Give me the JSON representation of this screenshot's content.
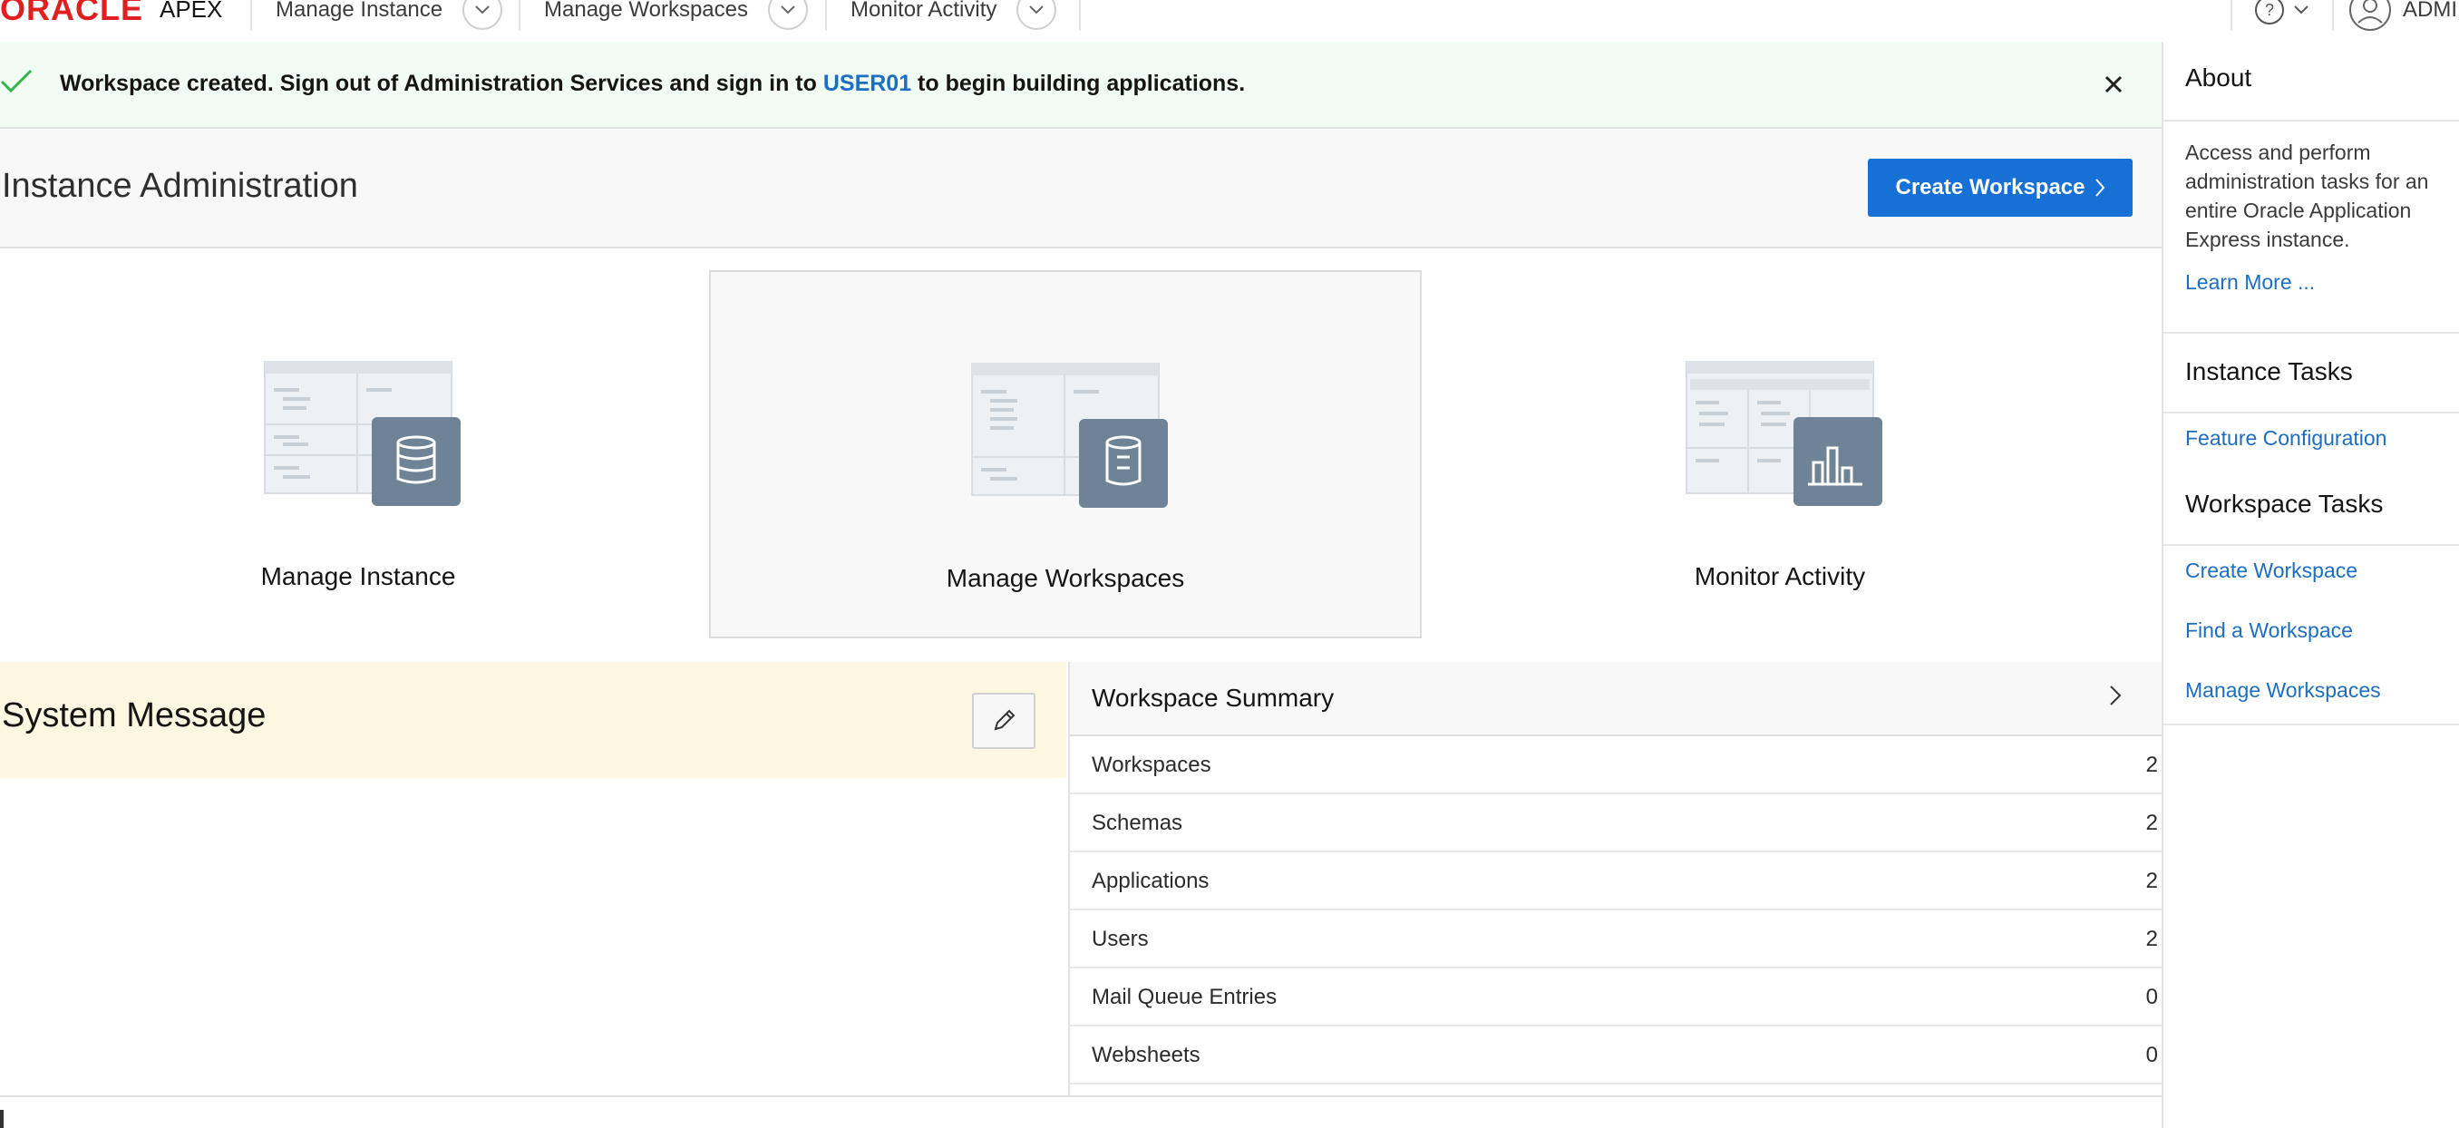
{
  "brand": {
    "logo_text": "ORACLE",
    "product": "APEX"
  },
  "nav": {
    "items": [
      {
        "label": "Manage Instance"
      },
      {
        "label": "Manage Workspaces"
      },
      {
        "label": "Monitor Activity"
      }
    ],
    "help_icon": "help-icon",
    "user_label": "ADMI"
  },
  "banner": {
    "text_before": "Workspace created. Sign out of Administration Services and sign in to ",
    "link": "USER01",
    "text_after": " to begin building applications.",
    "status_color": "#2fb54a"
  },
  "header": {
    "title": "Instance Administration",
    "create_button": "Create Workspace"
  },
  "cards": [
    {
      "label": "Manage Instance",
      "icon": "database-icon"
    },
    {
      "label": "Manage Workspaces",
      "icon": "workspace-db-icon"
    },
    {
      "label": "Monitor Activity",
      "icon": "bar-chart-icon"
    }
  ],
  "system_message": {
    "title": "System Message"
  },
  "workspace_summary": {
    "title": "Workspace Summary",
    "rows": [
      {
        "label": "Workspaces",
        "value": "2"
      },
      {
        "label": "Schemas",
        "value": "2"
      },
      {
        "label": "Applications",
        "value": "2"
      },
      {
        "label": "Users",
        "value": "2"
      },
      {
        "label": "Mail Queue Entries",
        "value": "0"
      },
      {
        "label": "Websheets",
        "value": "0"
      }
    ]
  },
  "sidebar": {
    "about_title": "About",
    "about_text": "Access and perform administration tasks for an entire Oracle Application Express instance.",
    "learn_more": "Learn More ...",
    "instance_tasks_title": "Instance Tasks",
    "instance_tasks": [
      "Feature Configuration"
    ],
    "workspace_tasks_title": "Workspace Tasks",
    "workspace_tasks": [
      "Create Workspace",
      "Find a Workspace",
      "Manage Workspaces"
    ]
  },
  "colors": {
    "accent": "#1770d6",
    "link": "#1b6ec2",
    "oracle_red": "#e02020",
    "system_message_bg": "#fdf7e1",
    "banner_bg": "#f1fcf4"
  }
}
